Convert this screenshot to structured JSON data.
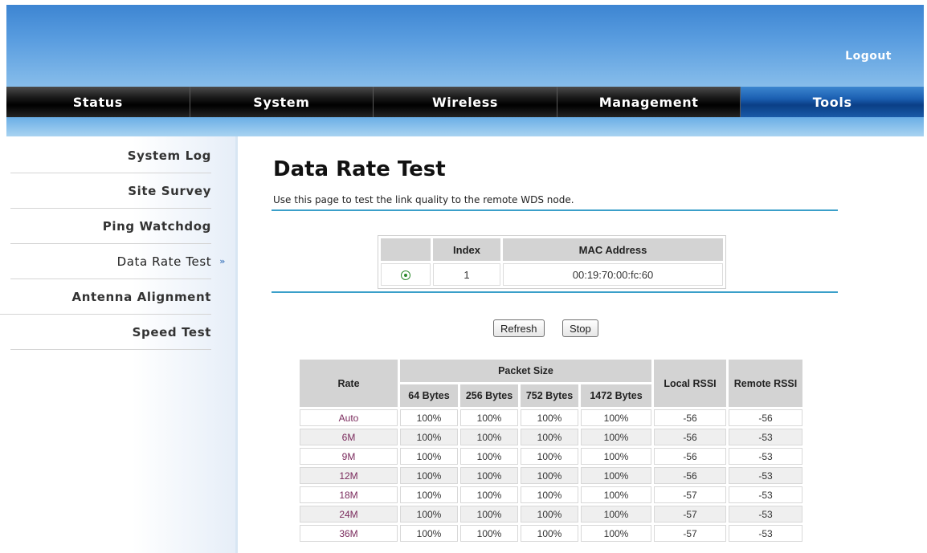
{
  "header": {
    "logout_label": "Logout"
  },
  "nav": {
    "tabs": [
      {
        "label": "Status"
      },
      {
        "label": "System"
      },
      {
        "label": "Wireless"
      },
      {
        "label": "Management"
      },
      {
        "label": "Tools"
      }
    ],
    "active": "Tools"
  },
  "sidebar": {
    "items": [
      {
        "label": "System Log"
      },
      {
        "label": "Site Survey"
      },
      {
        "label": "Ping Watchdog"
      },
      {
        "label": "Data Rate Test",
        "arrow": "»"
      },
      {
        "label": "Antenna Alignment"
      },
      {
        "label": "Speed Test"
      }
    ],
    "active": "Data Rate Test"
  },
  "main": {
    "title": "Data Rate Test",
    "description": "Use this page to test the link quality to the remote WDS node.",
    "mac_table": {
      "headers": [
        "",
        "Index",
        "MAC Address"
      ],
      "rows": [
        {
          "selected": true,
          "index": "1",
          "mac": "00:19:70:00:fc:60"
        }
      ]
    },
    "buttons": {
      "refresh": "Refresh",
      "stop": "Stop"
    },
    "rate_table": {
      "headers": {
        "rate": "Rate",
        "packet_size": "Packet Size",
        "sizes": [
          "64 Bytes",
          "256 Bytes",
          "752 Bytes",
          "1472 Bytes"
        ],
        "local_rssi": "Local RSSI",
        "remote_rssi": "Remote RSSI"
      },
      "rows": [
        {
          "rate": "Auto",
          "p64": "100%",
          "p256": "100%",
          "p752": "100%",
          "p1472": "100%",
          "local": "-56",
          "remote": "-56"
        },
        {
          "rate": "6M",
          "p64": "100%",
          "p256": "100%",
          "p752": "100%",
          "p1472": "100%",
          "local": "-56",
          "remote": "-53"
        },
        {
          "rate": "9M",
          "p64": "100%",
          "p256": "100%",
          "p752": "100%",
          "p1472": "100%",
          "local": "-56",
          "remote": "-53"
        },
        {
          "rate": "12M",
          "p64": "100%",
          "p256": "100%",
          "p752": "100%",
          "p1472": "100%",
          "local": "-56",
          "remote": "-53"
        },
        {
          "rate": "18M",
          "p64": "100%",
          "p256": "100%",
          "p752": "100%",
          "p1472": "100%",
          "local": "-57",
          "remote": "-53"
        },
        {
          "rate": "24M",
          "p64": "100%",
          "p256": "100%",
          "p752": "100%",
          "p1472": "100%",
          "local": "-57",
          "remote": "-53"
        },
        {
          "rate": "36M",
          "p64": "100%",
          "p256": "100%",
          "p752": "100%",
          "p1472": "100%",
          "local": "-57",
          "remote": "-53"
        }
      ]
    }
  }
}
